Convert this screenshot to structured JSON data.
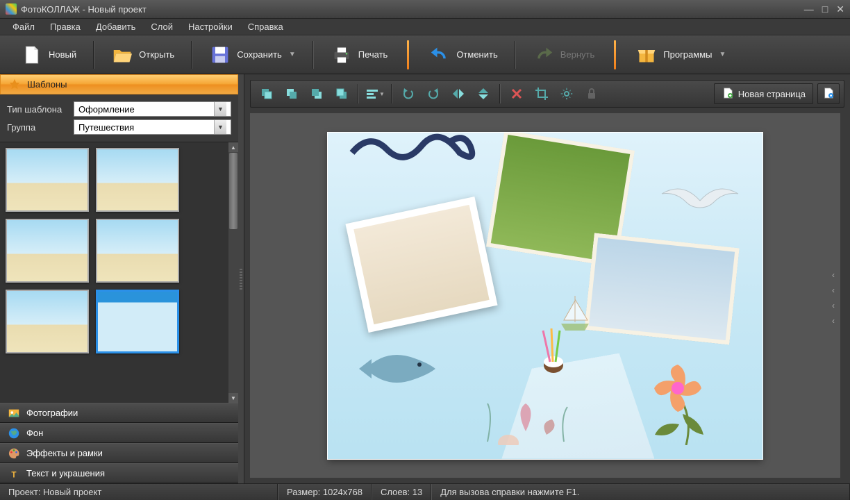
{
  "window": {
    "title": "ФотоКОЛЛАЖ - Новый проект"
  },
  "menu": {
    "file": "Файл",
    "edit": "Правка",
    "add": "Добавить",
    "layer": "Слой",
    "settings": "Настройки",
    "help": "Справка"
  },
  "toolbar": {
    "new": "Новый",
    "open": "Открыть",
    "save": "Сохранить",
    "print": "Печать",
    "undo": "Отменить",
    "redo": "Вернуть",
    "programs": "Программы"
  },
  "sidebar": {
    "templates": "Шаблоны",
    "type_label": "Тип шаблона",
    "type_value": "Оформление",
    "group_label": "Группа",
    "group_value": "Путешествия",
    "photos": "Фотографии",
    "background": "Фон",
    "effects": "Эффекты и рамки",
    "text": "Текст и украшения"
  },
  "canvas_toolbar": {
    "new_page": "Новая страница"
  },
  "status": {
    "project": "Проект: Новый проект",
    "size": "Размер: 1024x768",
    "layers": "Слоев: 13",
    "help": "Для вызова справки нажмите F1."
  }
}
